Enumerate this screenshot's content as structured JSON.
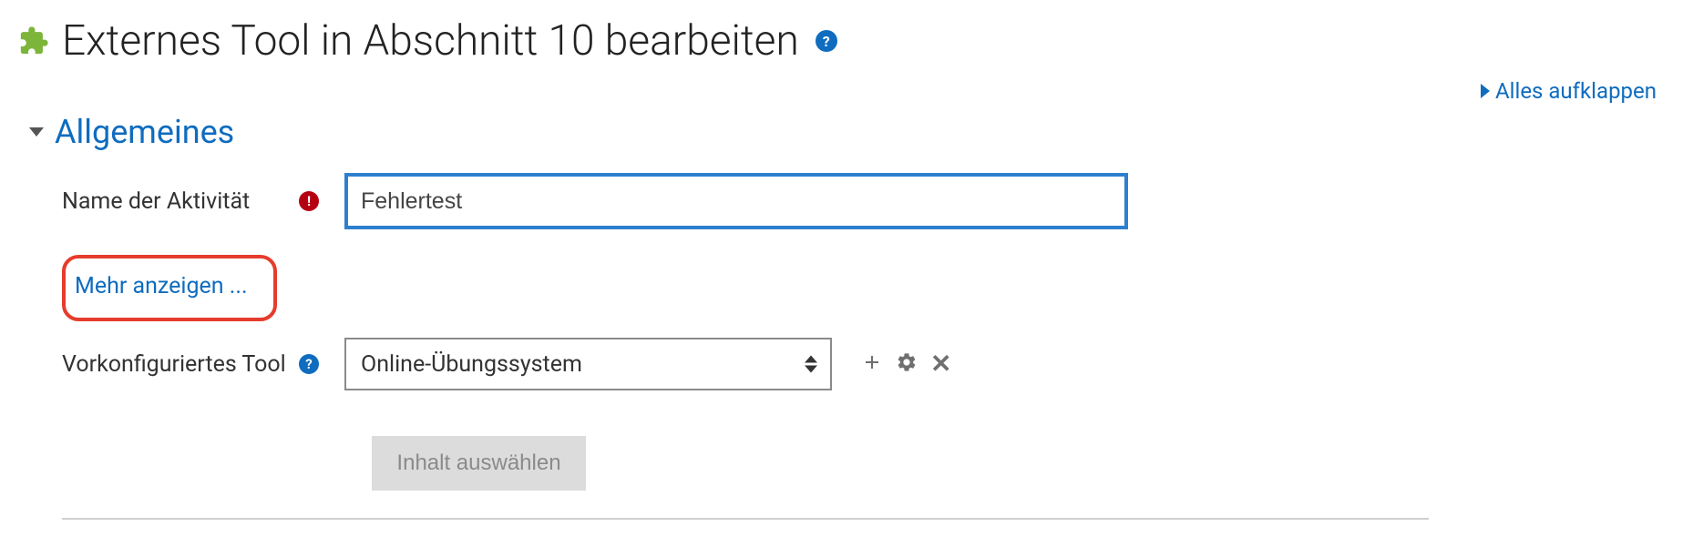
{
  "page": {
    "title": "Externes Tool in Abschnitt 10 bearbeiten"
  },
  "actions": {
    "expand_all": "Alles aufklappen"
  },
  "section": {
    "general": "Allgemeines"
  },
  "fields": {
    "activity_name": {
      "label": "Name der Aktivität",
      "value": "Fehlertest"
    },
    "show_more": "Mehr anzeigen ...",
    "preconfigured_tool": {
      "label": "Vorkonfiguriertes Tool",
      "selected": "Online-Übungssystem"
    },
    "select_content": "Inhalt auswählen"
  }
}
